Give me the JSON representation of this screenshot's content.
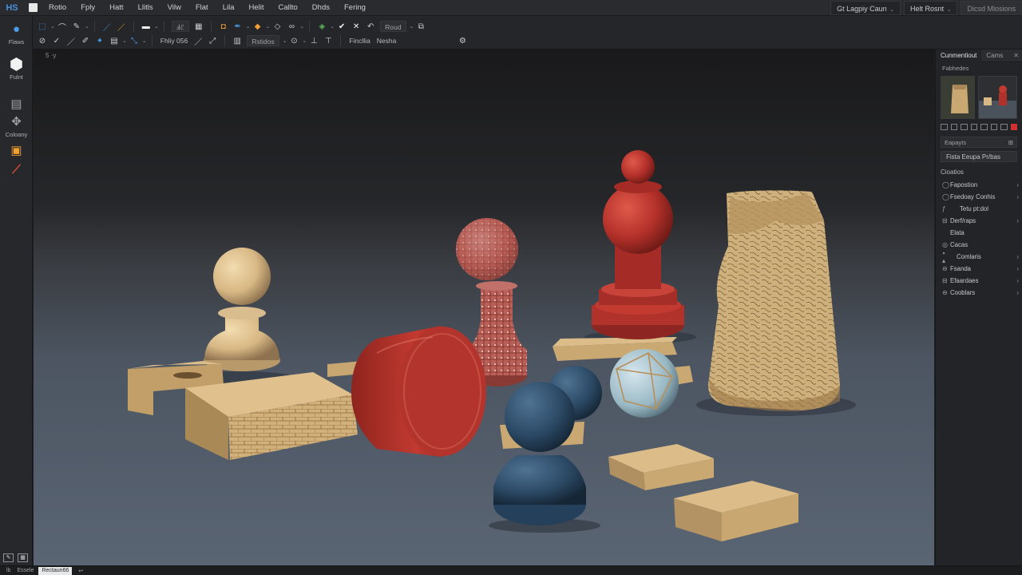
{
  "app": {
    "logo": "HS",
    "menu": [
      "Rotio",
      "Fply",
      "Hatt",
      "Llitls",
      "Vilw",
      "Flat",
      "Lila",
      "Helit",
      "Callto",
      "Dhds",
      "Fering"
    ],
    "right_buttons": [
      {
        "label": "Gt Lagpiy Caun",
        "caret": "⌄"
      },
      {
        "label": "Helt Rosnt",
        "caret": "⌄"
      },
      {
        "label": "Dicsd Mlosions"
      }
    ]
  },
  "options": {
    "row1_field1": "Ⅎℰ",
    "row1_field2": "Roud",
    "row2_text1": "Fhliy 056",
    "row2_text2": "Rstidos",
    "row2_text3": "Fincllia",
    "row2_text4": "Nesha"
  },
  "left_tools": [
    {
      "icon": "●",
      "label": "Flaws",
      "color": "#4c9be8"
    },
    {
      "icon": "⬡",
      "label": "Fulnt",
      "color": "#f2f2f2"
    },
    {
      "icon": "▤",
      "label": "",
      "color": "#a0a3a7"
    },
    {
      "icon": "✥",
      "label": "Coloany",
      "color": "#a0a3a7"
    },
    {
      "icon": "▣",
      "label": "",
      "color": "#f0a030"
    },
    {
      "icon": "⁄",
      "label": "",
      "color": "#d84a3a"
    }
  ],
  "canvas": {
    "tag": "5 ·y"
  },
  "right_panel": {
    "tabs": [
      "Cunmentiout",
      "Cams"
    ],
    "subtitle": "Fabhedes",
    "search_label": "Eapayts",
    "field_value": "Fista Eeupa Pr/bas",
    "section_header": "Cioatios",
    "layers": [
      {
        "icon": "◯",
        "label": "Fapostion",
        "indent": 0,
        "arrow": "›"
      },
      {
        "icon": "◯",
        "label": "Fsedoay Conhis",
        "indent": 0,
        "arrow": "›"
      },
      {
        "icon": "ƒ",
        "label": "Tetu pt:dol",
        "indent": 1,
        "arrow": ""
      },
      {
        "icon": "⊟",
        "label": "Derf/raps",
        "indent": 0,
        "arrow": "›"
      },
      {
        "icon": "",
        "label": "Elata",
        "indent": 0,
        "arrow": ""
      },
      {
        "icon": "◎",
        "label": "Cacas",
        "indent": 0,
        "arrow": ""
      },
      {
        "icon": "‣ ▴",
        "label": "Comlaris",
        "indent": 0,
        "arrow": "›"
      },
      {
        "icon": "⊖",
        "label": "Fsanda",
        "indent": 0,
        "arrow": "›"
      },
      {
        "icon": "⊟",
        "label": "Efaardaes",
        "indent": 0,
        "arrow": "›"
      },
      {
        "icon": "⊖",
        "label": "Cooblars",
        "indent": 0,
        "arrow": "›"
      }
    ]
  },
  "status": {
    "item1": "lb",
    "item2": "Essele",
    "active": "Rectaun66",
    "item3": "↩"
  }
}
